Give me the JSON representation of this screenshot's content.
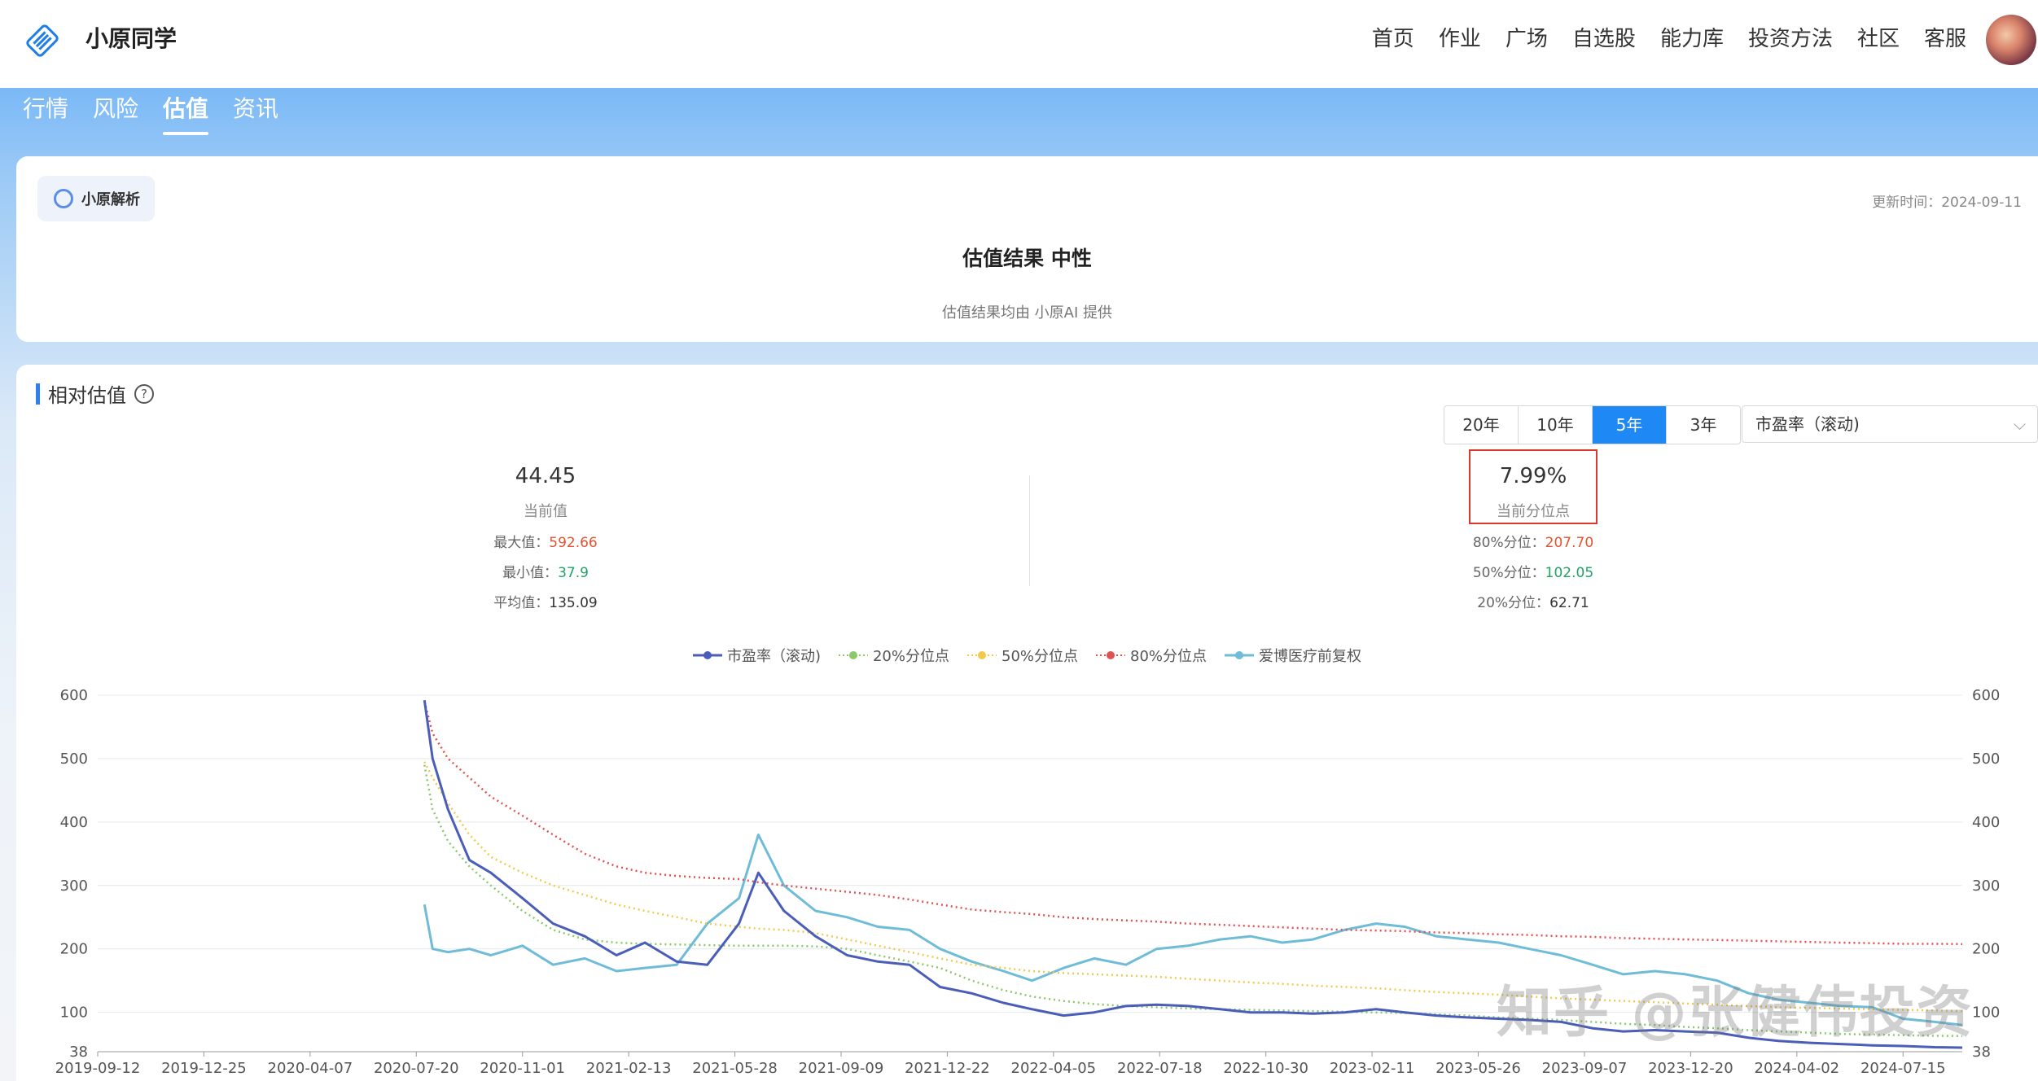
{
  "app": {
    "brand": "小原同学"
  },
  "nav": [
    "首页",
    "作业",
    "广场",
    "自选股",
    "能力库",
    "投资方法",
    "社区",
    "客服"
  ],
  "subtabs": [
    "行情",
    "风险",
    "估值",
    "资讯"
  ],
  "active_subtab": "估值",
  "summary": {
    "chip_label": "小原解析",
    "update_time": "更新时间：2024-09-11",
    "result": "估值结果  中性",
    "source": "估值结果均由 小原AI 提供"
  },
  "relative": {
    "title": "相对估值",
    "help": "?",
    "periods": [
      "20年",
      "10年",
      "5年",
      "3年"
    ],
    "active_period": "5年",
    "metric": "市盈率（滚动)",
    "current": {
      "value": "44.45",
      "caption": "当前值",
      "max_label": "最大值：",
      "max": "592.66",
      "min_label": "最小值：",
      "min": "37.9",
      "avg_label": "平均值：",
      "avg": "135.09"
    },
    "percentile": {
      "value": "7.99%",
      "caption": "当前分位点",
      "p80_label": "80%分位：",
      "p80": "207.70",
      "p50_label": "50%分位：",
      "p50": "102.05",
      "p20_label": "20%分位：",
      "p20": "62.71"
    }
  },
  "watermark": "知乎 @张健伟投资",
  "chart_data": {
    "type": "line",
    "legend": [
      "市盈率（滚动)",
      "20%分位点",
      "50%分位点",
      "80%分位点",
      "爱博医疗前复权"
    ],
    "colors": {
      "pe": "#4a5db8",
      "p20": "#8ac86a",
      "p50": "#f2c94c",
      "p80": "#e05252",
      "price": "#6fbcd8"
    },
    "x_ticks": [
      "2019-09-12",
      "2019-12-25",
      "2020-04-07",
      "2020-07-20",
      "2020-11-01",
      "2021-02-13",
      "2021-05-28",
      "2021-09-09",
      "2021-12-22",
      "2022-04-05",
      "2022-07-18",
      "2022-10-30",
      "2023-02-11",
      "2023-05-26",
      "2023-09-07",
      "2023-12-20",
      "2024-04-02",
      "2024-07-15"
    ],
    "y_ticks": [
      "600",
      "500",
      "400",
      "300",
      "200",
      "100",
      "38"
    ],
    "ylim": [
      38,
      600
    ],
    "x": [
      "2020-07-28",
      "2020-08-05",
      "2020-08-20",
      "2020-09-10",
      "2020-10-01",
      "2020-11-01",
      "2020-12-01",
      "2021-01-01",
      "2021-02-01",
      "2021-03-01",
      "2021-04-01",
      "2021-05-01",
      "2021-06-01",
      "2021-06-20",
      "2021-07-15",
      "2021-08-15",
      "2021-09-15",
      "2021-10-15",
      "2021-11-15",
      "2021-12-15",
      "2022-01-15",
      "2022-02-15",
      "2022-03-15",
      "2022-04-15",
      "2022-05-15",
      "2022-06-15",
      "2022-07-15",
      "2022-08-15",
      "2022-09-15",
      "2022-10-15",
      "2022-11-15",
      "2022-12-15",
      "2023-01-15",
      "2023-02-15",
      "2023-03-15",
      "2023-04-15",
      "2023-05-15",
      "2023-06-15",
      "2023-07-15",
      "2023-08-15",
      "2023-09-15",
      "2023-10-15",
      "2023-11-15",
      "2023-12-15",
      "2024-01-15",
      "2024-02-15",
      "2024-03-15",
      "2024-04-15",
      "2024-05-15",
      "2024-06-15",
      "2024-07-15",
      "2024-08-15",
      "2024-09-11"
    ],
    "series": [
      {
        "name": "市盈率（滚动)",
        "key": "pe",
        "style": "solid",
        "values": [
          592,
          500,
          420,
          340,
          320,
          280,
          240,
          220,
          190,
          210,
          180,
          175,
          240,
          320,
          260,
          220,
          190,
          180,
          175,
          140,
          130,
          115,
          105,
          95,
          100,
          110,
          112,
          110,
          105,
          100,
          100,
          98,
          100,
          105,
          100,
          95,
          92,
          90,
          88,
          85,
          75,
          70,
          72,
          70,
          68,
          60,
          55,
          52,
          50,
          48,
          47,
          45,
          44.45
        ]
      },
      {
        "name": "20%分位点",
        "key": "p20",
        "style": "dotted",
        "values": [
          490,
          420,
          370,
          330,
          300,
          260,
          230,
          215,
          210,
          208,
          207,
          206,
          205,
          205,
          205,
          204,
          200,
          190,
          180,
          170,
          150,
          135,
          125,
          118,
          113,
          110,
          108,
          106,
          105,
          104,
          103,
          102,
          101,
          100,
          99,
          97,
          95,
          92,
          90,
          88,
          85,
          82,
          80,
          77,
          75,
          72,
          70,
          68,
          66,
          65,
          64,
          63,
          62.71
        ]
      },
      {
        "name": "50%分位点",
        "key": "p50",
        "style": "dotted",
        "values": [
          495,
          470,
          430,
          380,
          345,
          320,
          300,
          285,
          270,
          260,
          250,
          240,
          235,
          232,
          230,
          225,
          215,
          205,
          195,
          185,
          175,
          170,
          165,
          162,
          160,
          158,
          156,
          153,
          150,
          147,
          145,
          142,
          140,
          138,
          135,
          132,
          130,
          128,
          125,
          122,
          120,
          118,
          116,
          114,
          112,
          110,
          108,
          107,
          106,
          105,
          104,
          103,
          102.05
        ]
      },
      {
        "name": "80%分位点",
        "key": "p80",
        "style": "dotted",
        "values": [
          590,
          540,
          500,
          470,
          440,
          410,
          380,
          350,
          330,
          320,
          315,
          312,
          310,
          305,
          300,
          295,
          290,
          285,
          278,
          270,
          262,
          258,
          255,
          250,
          247,
          245,
          243,
          240,
          238,
          236,
          234,
          232,
          230,
          229,
          228,
          226,
          225,
          223,
          222,
          220,
          219,
          217,
          216,
          215,
          214,
          213,
          212,
          211,
          210,
          209,
          208,
          208,
          207.7
        ]
      },
      {
        "name": "爱博医疗前复权",
        "key": "price",
        "style": "solid",
        "values": [
          270,
          200,
          195,
          200,
          190,
          205,
          175,
          185,
          165,
          170,
          175,
          240,
          280,
          380,
          300,
          260,
          250,
          235,
          230,
          200,
          180,
          165,
          150,
          170,
          185,
          175,
          200,
          205,
          215,
          220,
          210,
          215,
          230,
          240,
          235,
          220,
          215,
          210,
          200,
          190,
          175,
          160,
          165,
          160,
          150,
          130,
          120,
          115,
          110,
          108,
          90,
          85,
          80
        ]
      }
    ]
  }
}
